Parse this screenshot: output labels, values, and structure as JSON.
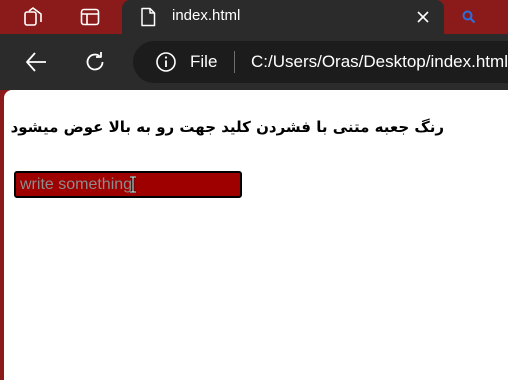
{
  "tab": {
    "title": "index.html",
    "close_icon": "close-icon",
    "page_icon": "document-icon"
  },
  "toolbar": {
    "back_icon": "back-arrow-icon",
    "reload_icon": "reload-icon",
    "scheme_label": "File",
    "url": "C:/Users/Oras/Desktop/index.html"
  },
  "page": {
    "heading": "رنگ جعبه متنی با فشردن کلید جهت رو به بالا عوض میشود",
    "input": {
      "value": "",
      "placeholder": "write something",
      "background": "#9e0000"
    }
  },
  "colors": {
    "frame": "#8b1a1a",
    "toolbar": "#2b2b2b",
    "address_bar": "#1c1c1c",
    "accent": "#2a6fe0"
  }
}
